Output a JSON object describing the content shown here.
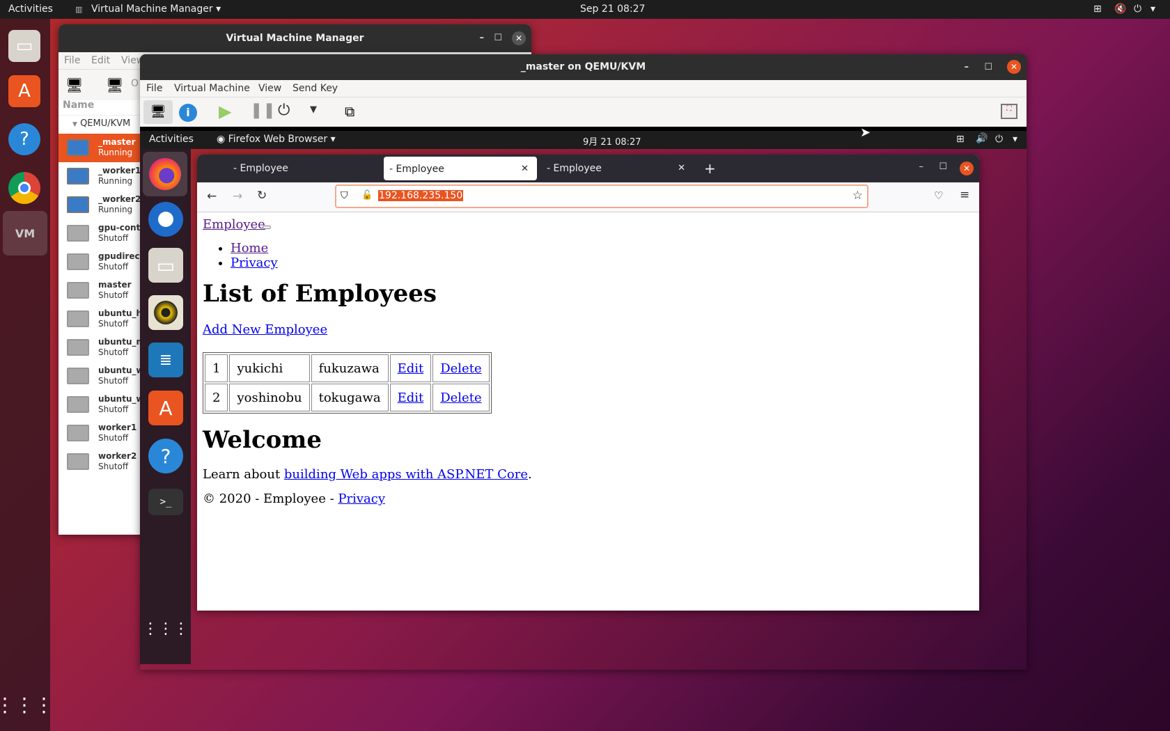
{
  "host_topbar": {
    "activities": "Activities",
    "app_menu": "Virtual Machine Manager",
    "clock": "Sep 21  08:27"
  },
  "host_dock": [
    "files-icon",
    "app-store-icon",
    "help-icon",
    "chrome-icon",
    "virt-manager-icon",
    "app-grid-icon"
  ],
  "vmm": {
    "title": "Virtual Machine Manager",
    "menu": [
      "File",
      "Edit",
      "View"
    ],
    "toolbar_open": "O",
    "column_name": "Name",
    "connection": "QEMU/KVM",
    "vms": [
      {
        "name": "_master",
        "status": "Running"
      },
      {
        "name": "_worker1",
        "status": "Running"
      },
      {
        "name": "_worker2",
        "status": "Running"
      },
      {
        "name": "gpu-contai",
        "status": "Shutoff"
      },
      {
        "name": "gpudirect",
        "status": "Shutoff"
      },
      {
        "name": "master",
        "status": "Shutoff"
      },
      {
        "name": "ubuntu_ha",
        "status": "Shutoff"
      },
      {
        "name": "ubuntu_ma",
        "status": "Shutoff"
      },
      {
        "name": "ubuntu_wo",
        "status": "Shutoff"
      },
      {
        "name": "ubuntu_wo",
        "status": "Shutoff"
      },
      {
        "name": "worker1",
        "status": "Shutoff"
      },
      {
        "name": "worker2",
        "status": "Shutoff"
      }
    ]
  },
  "console": {
    "title": "_master on QEMU/KVM",
    "menu": [
      "File",
      "Virtual Machine",
      "View",
      "Send Key"
    ]
  },
  "guest_topbar": {
    "activities": "Activities",
    "app_menu": "Firefox Web Browser",
    "clock": "9月 21  08:27"
  },
  "firefox": {
    "tabs": [
      {
        "label": "- Employee"
      },
      {
        "label": "- Employee"
      },
      {
        "label": "- Employee"
      }
    ],
    "new_tab": "+",
    "url": "192.168.235.150"
  },
  "page": {
    "brand": "Employee",
    "nav": [
      "Home",
      "Privacy"
    ],
    "heading": "List of Employees",
    "add_link": "Add New Employee",
    "rows": [
      {
        "id": "1",
        "first": "yukichi",
        "last": "fukuzawa",
        "edit": "Edit",
        "delete": "Delete"
      },
      {
        "id": "2",
        "first": "yoshinobu",
        "last": "tokugawa",
        "edit": "Edit",
        "delete": "Delete"
      }
    ],
    "welcome": "Welcome",
    "learn_prefix": "Learn about ",
    "learn_link": "building Web apps with ASP.NET Core",
    "learn_suffix": ".",
    "footer_prefix": "© 2020 - Employee - ",
    "footer_link": "Privacy"
  },
  "colors": {
    "accent": "#e95420",
    "link": "#0000ee",
    "visited": "#551a8b"
  }
}
